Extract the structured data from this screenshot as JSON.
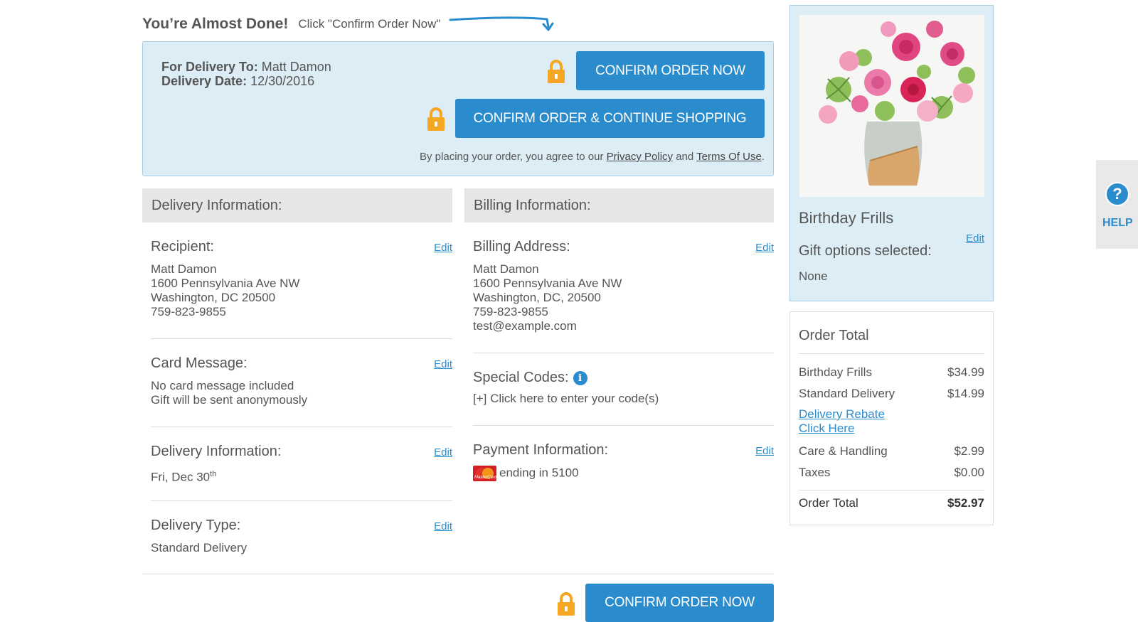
{
  "header": {
    "almost_done": "You’re Almost Done!",
    "instruction": "Click \"Confirm Order Now\""
  },
  "confirm_box": {
    "delivery_to_label": "For Delivery To:",
    "delivery_to_value": "Matt Damon",
    "delivery_date_label": "Delivery Date:",
    "delivery_date_value": "12/30/2016",
    "confirm_label": "CONFIRM ORDER NOW",
    "continue_label": "CONFIRM ORDER & CONTINUE SHOPPING",
    "agree_prefix": "By placing your order, you agree to our",
    "privacy_link": "Privacy Policy",
    "and_text": "and",
    "terms_link": "Terms Of Use",
    "period": "."
  },
  "delivery": {
    "header": "Delivery Information:",
    "recipient_title": "Recipient:",
    "recipient_lines": [
      "Matt Damon",
      "1600 Pennsylvania Ave NW",
      "Washington, DC 20500",
      "759-823-9855"
    ],
    "card_title": "Card Message:",
    "card_lines": [
      "No card message included",
      "Gift will be sent anonymously"
    ],
    "info_title": "Delivery Information:",
    "info_date": "Fri, Dec 30",
    "info_date_sup": "th",
    "type_title": "Delivery Type:",
    "type_value": "Standard Delivery",
    "edit_label": "Edit"
  },
  "billing": {
    "header": "Billing Information:",
    "address_title": "Billing Address:",
    "address_lines": [
      "Matt Damon",
      "1600 Pennsylvania Ave NW",
      "Washington, DC, 20500",
      "759-823-9855",
      "test@example.com"
    ],
    "codes_title": "Special Codes:",
    "codes_link": "[+] Click here to enter your code(s)",
    "payment_title": "Payment Information:",
    "payment_card_text": "MasterCard",
    "payment_ending": "ending in 5100",
    "edit_label": "Edit"
  },
  "product": {
    "name": "Birthday Frills",
    "edit_label": "Edit",
    "gift_label": "Gift options selected:",
    "gift_value": "None"
  },
  "order_total": {
    "title": "Order Total",
    "rows": [
      {
        "label": "Birthday Frills",
        "amount": "$34.99"
      },
      {
        "label": "Standard Delivery",
        "amount": "$14.99"
      },
      {
        "label": "Care & Handling",
        "amount": "$2.99"
      },
      {
        "label": "Taxes",
        "amount": "$0.00"
      }
    ],
    "rebate_line1": "Delivery Rebate",
    "rebate_line2": "Click Here",
    "final_label": "Order Total",
    "final_amount": "$52.97"
  },
  "bottom": {
    "confirm_label": "CONFIRM ORDER NOW"
  },
  "help": {
    "q": "?",
    "label": "HELP"
  },
  "colors": {
    "accent": "#2b8ccd",
    "panel_bg": "#dcedf6",
    "lock": "#f5a623"
  },
  "icons": [
    "arrow-curve-icon",
    "lock-icon",
    "info-icon",
    "mastercard-icon",
    "help-icon"
  ]
}
